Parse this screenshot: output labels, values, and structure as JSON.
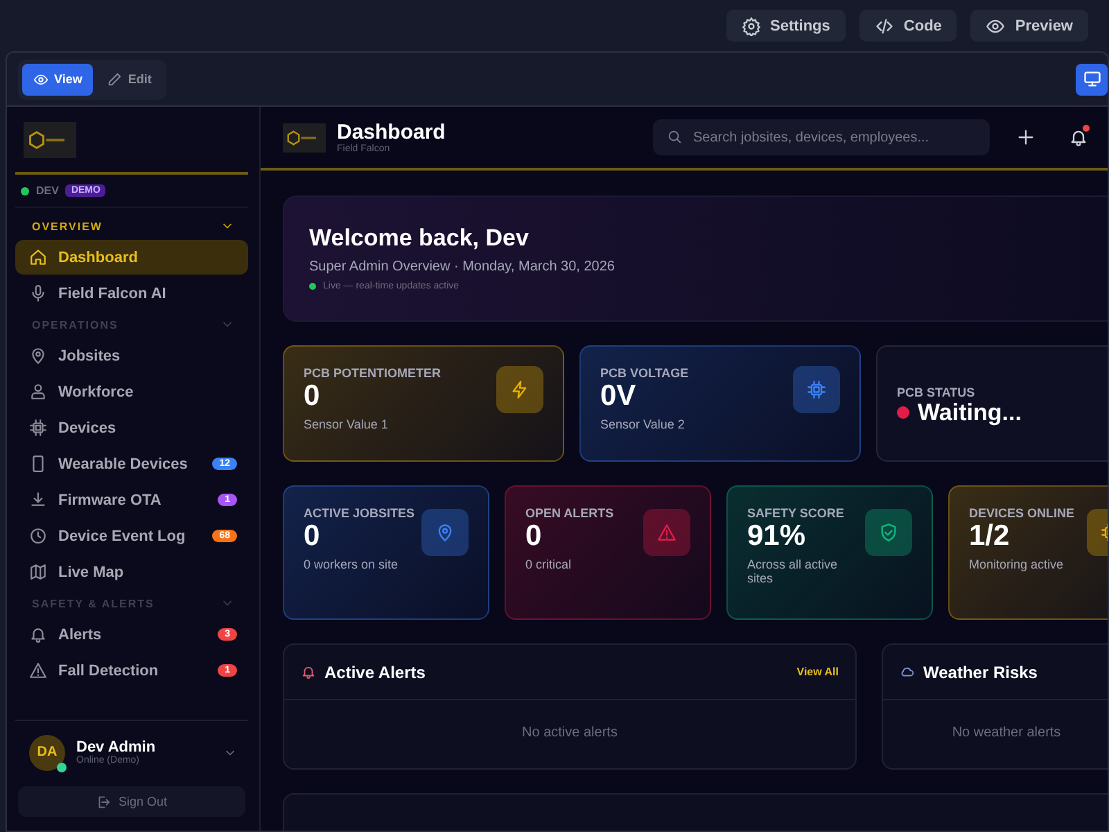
{
  "top_bar": {
    "buttons": [
      "Settings",
      "Code",
      "Preview"
    ]
  },
  "mode_toggle": [
    {
      "label": "View",
      "selected": true
    },
    {
      "label": "Edit",
      "selected": false
    }
  ],
  "sidebar": {
    "env": {
      "label": "DEV",
      "badge": "DEMO"
    },
    "sections": [
      {
        "label": "OVERVIEW",
        "expanded": true,
        "items": [
          {
            "label": "Dashboard",
            "selected": true
          },
          {
            "label": "Field Falcon AI",
            "selected": false
          }
        ]
      },
      {
        "label": "OPERATIONS",
        "expanded": true,
        "items": [
          {
            "label": "Jobsites",
            "selected": false
          },
          {
            "label": "Workforce",
            "selected": false
          },
          {
            "label": "Devices",
            "selected": false
          },
          {
            "label": "Wearable Devices",
            "selected": false,
            "badge": "12",
            "color": "#3b82f6"
          },
          {
            "label": "Firmware OTA",
            "selected": false,
            "badge": "1",
            "color": "#a855f7"
          },
          {
            "label": "Device Event Log",
            "selected": false,
            "badge": "68",
            "color": "#f97316"
          },
          {
            "label": "Live Map",
            "selected": false
          }
        ]
      },
      {
        "label": "SAFETY & ALERTS",
        "expanded": true,
        "items": [
          {
            "label": "Alerts",
            "selected": false,
            "badge": "3",
            "color": "#ef4444"
          },
          {
            "label": "Fall Detection",
            "selected": false,
            "badge": "1",
            "color": "#ef4444"
          }
        ]
      }
    ],
    "user": {
      "initials": "DA",
      "name": "Dev Admin",
      "status": "Online (Demo)",
      "online": true
    },
    "sign_out": "Sign Out"
  },
  "header": {
    "title": "Dashboard",
    "subtitle": "Field Falcon",
    "search": {
      "placeholder": "Search jobsites, devices, employees..."
    },
    "notifications_unread": true
  },
  "welcome": {
    "title": "Welcome back, Dev",
    "subtitle": "Super Admin Overview · Monday, March 30, 2026",
    "live": "Live — real-time updates active"
  },
  "sensor_cards": [
    {
      "label": "PCB POTENTIOMETER",
      "value": "0",
      "note": "Sensor Value 1",
      "color": "#eab308"
    },
    {
      "label": "PCB VOLTAGE",
      "value": "0V",
      "note": "Sensor Value 2",
      "color": "#3b82f6"
    },
    {
      "label": "PCB STATUS",
      "value": "Waiting...",
      "online": false
    }
  ],
  "stat_cards": [
    {
      "label": "ACTIVE JOBSITES",
      "value": "0",
      "note": "0 workers on site",
      "color": "#3b82f6"
    },
    {
      "label": "OPEN ALERTS",
      "value": "0",
      "note": "0 critical",
      "color": "#e11d48"
    },
    {
      "label": "SAFETY SCORE",
      "value": "91%",
      "note": "Across all active sites",
      "color": "#10b981"
    },
    {
      "label": "DEVICES ONLINE",
      "value": "1/2",
      "note": "Monitoring active",
      "color": "#eab308"
    }
  ],
  "panels": [
    {
      "title": "Active Alerts",
      "link": "View All",
      "empty": "No active alerts"
    },
    {
      "title": "Weather Risks",
      "empty": "No weather alerts"
    }
  ]
}
